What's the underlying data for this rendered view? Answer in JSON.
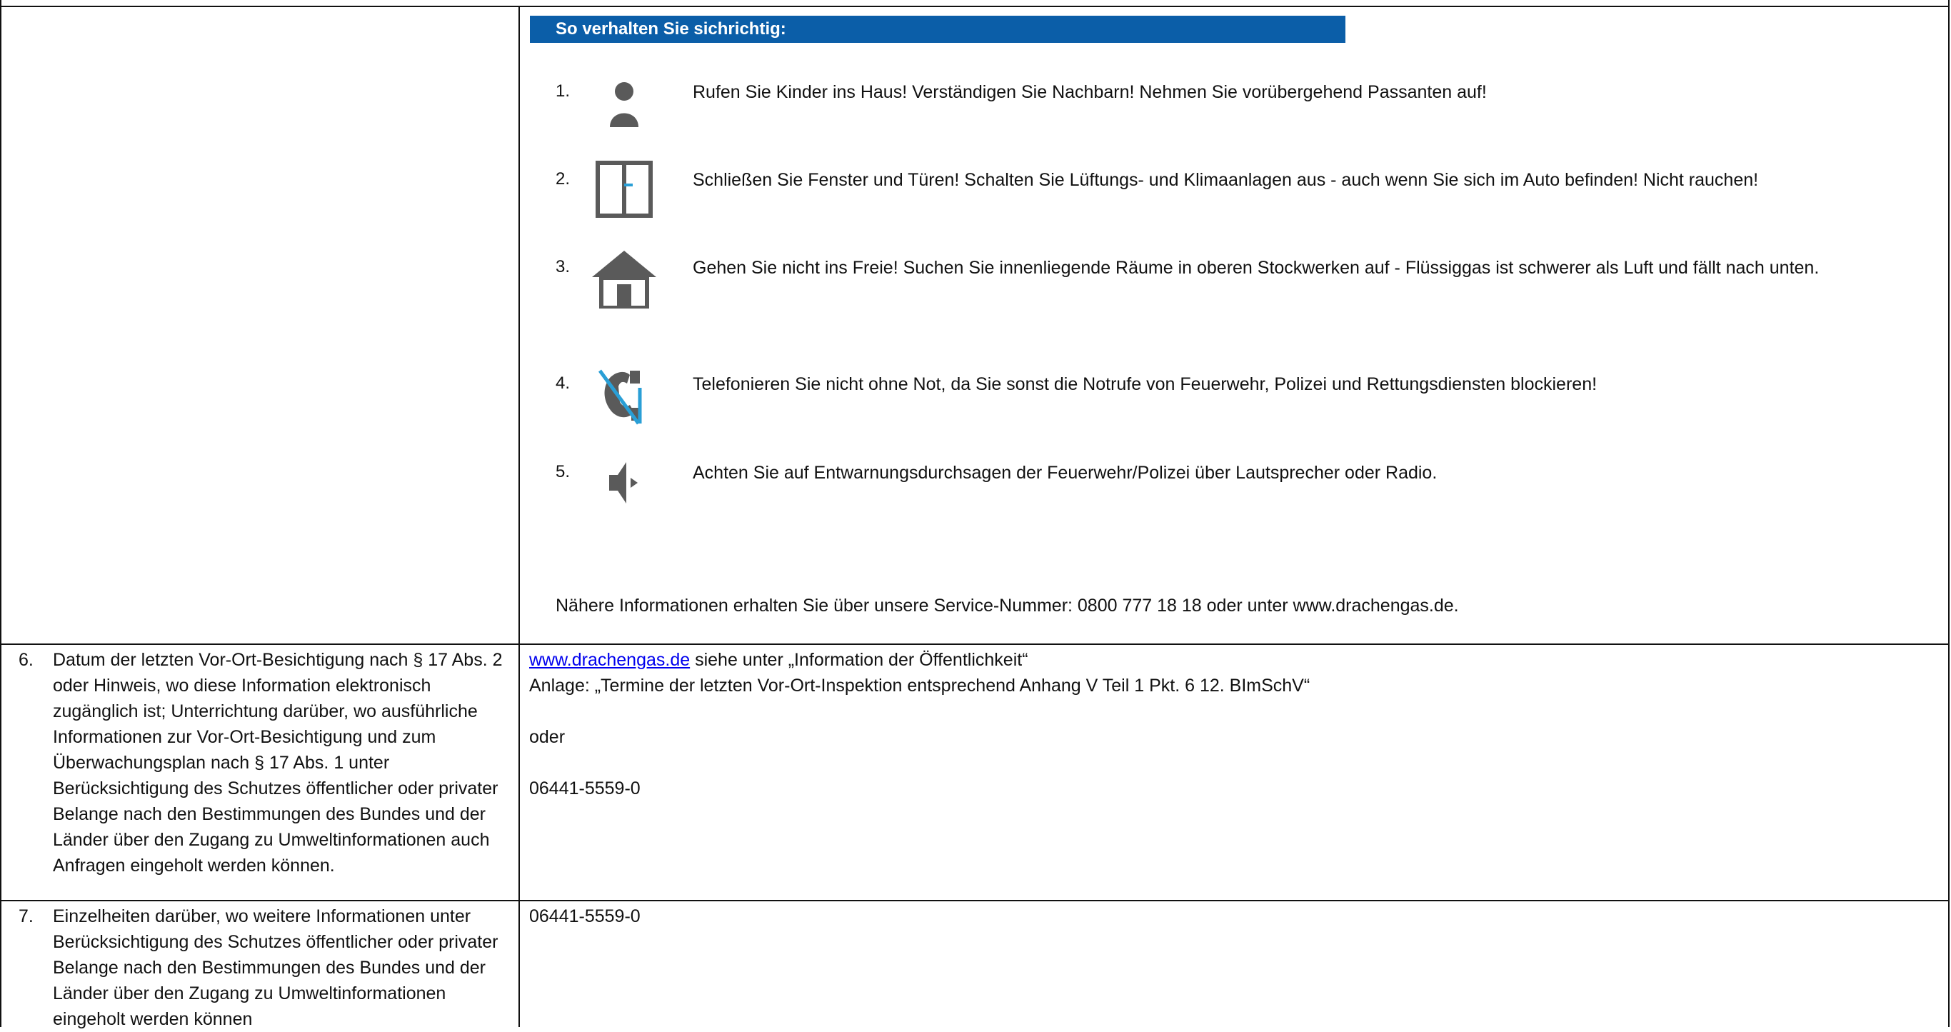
{
  "banner": {
    "title": "So verhalten Sie sichrichtig:"
  },
  "steps": [
    {
      "num": "1.",
      "icon": "person-icon",
      "text": "Rufen Sie Kinder ins Haus! Verständigen Sie Nachbarn! Nehmen Sie vorübergehend Passanten auf!"
    },
    {
      "num": "2.",
      "icon": "window-icon",
      "text": "Schließen Sie Fenster und Türen! Schalten Sie Lüftungs- und Klimaanlagen aus - auch wenn Sie sich im Auto befinden! Nicht rauchen!"
    },
    {
      "num": "3.",
      "icon": "house-icon",
      "text": "Gehen Sie nicht ins Freie! Suchen Sie innenliegende Räume in oberen Stockwerken auf - Flüssiggas ist schwerer als Luft und fällt nach unten."
    },
    {
      "num": "4.",
      "icon": "no-phone-icon",
      "text": "Telefonieren Sie nicht ohne Not, da Sie sonst die Notrufe von Feuerwehr, Polizei und Rettungsdiensten blockieren!"
    },
    {
      "num": "5.",
      "icon": "speaker-icon",
      "text": "Achten Sie auf Entwarnungsdurchsagen der Feuerwehr/Polizei über Lautsprecher oder Radio."
    }
  ],
  "info": "Nähere Informationen erhalten Sie über unsere Service-Nummer: 0800 777 18 18 oder unter www.drachengas.de.",
  "row6": {
    "num": "6.",
    "label": "Datum der letzten Vor-Ort-Besichtigung nach § 17 Abs. 2 oder Hinweis, wo diese Information elektronisch zugänglich ist; Unterrichtung darüber, wo ausführliche Informationen zur Vor-Ort-Besichtigung und zum Überwachungsplan nach § 17 Abs. 1 unter Berücksichtigung des Schutzes öffentlicher oder privater Belange nach den Bestimmungen des Bundes und der Länder über den Zugang zu Umweltinformationen auch Anfragen eingeholt werden können.",
    "link": "www.drachengas.de",
    "link_suffix": " siehe unter „Information der Öffentlichkeit“",
    "line2": "Anlage: „Termine der letzten Vor-Ort-Inspektion entsprechend Anhang V Teil 1 Pkt. 6 12. BImSchV“",
    "line3": "oder",
    "line4": "06441-5559-0"
  },
  "row7": {
    "num": "7.",
    "label": "Einzelheiten darüber, wo weitere Informationen unter Berücksichtigung des Schutzes öffentlicher oder privater Belange nach den Bestimmungen des Bundes und der Länder über den Zugang zu Umweltinformationen eingeholt werden können",
    "value": "06441-5559-0"
  },
  "colors": {
    "banner": "#0b5ea8",
    "icon_gray": "#5a5a5a",
    "accent_blue": "#2a9fd6",
    "link": "#0000ee"
  }
}
